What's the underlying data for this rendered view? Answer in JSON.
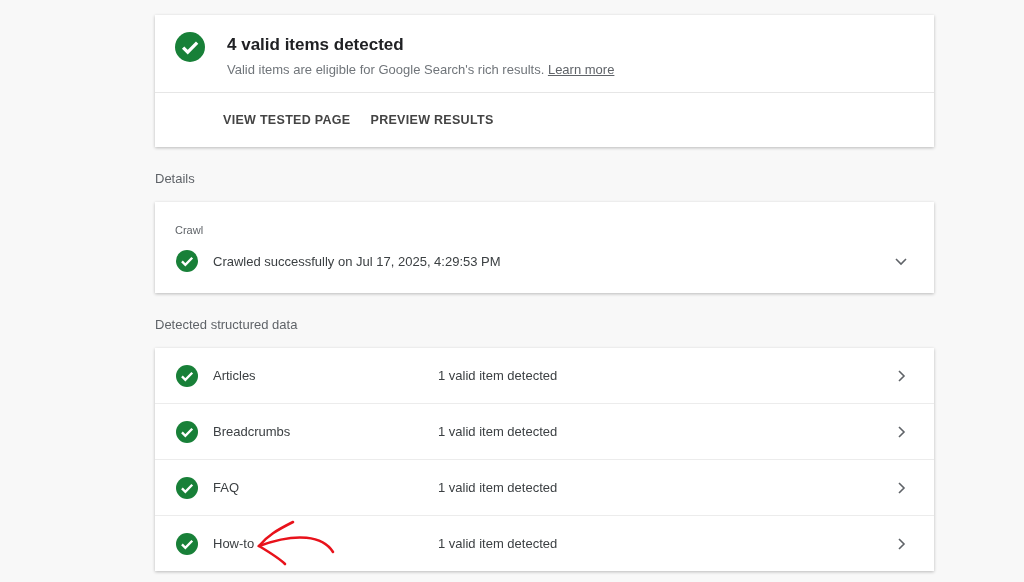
{
  "summary": {
    "title": "4 valid items detected",
    "description": "Valid items are eligible for Google Search's rich results.",
    "link": "Learn more",
    "actions": [
      "VIEW TESTED PAGE",
      "PREVIEW RESULTS"
    ]
  },
  "details": {
    "heading": "Details",
    "section": "Crawl",
    "status": "Crawled successfully on Jul 17, 2025, 4:29:53 PM",
    "expanded": false
  },
  "structured_data": {
    "heading": "Detected structured data",
    "items": [
      {
        "name": "Articles",
        "result": "1 valid item detected"
      },
      {
        "name": "Breadcrumbs",
        "result": "1 valid item detected"
      },
      {
        "name": "FAQ",
        "result": "1 valid item detected"
      },
      {
        "name": "How-to",
        "result": "1 valid item detected"
      }
    ]
  }
}
